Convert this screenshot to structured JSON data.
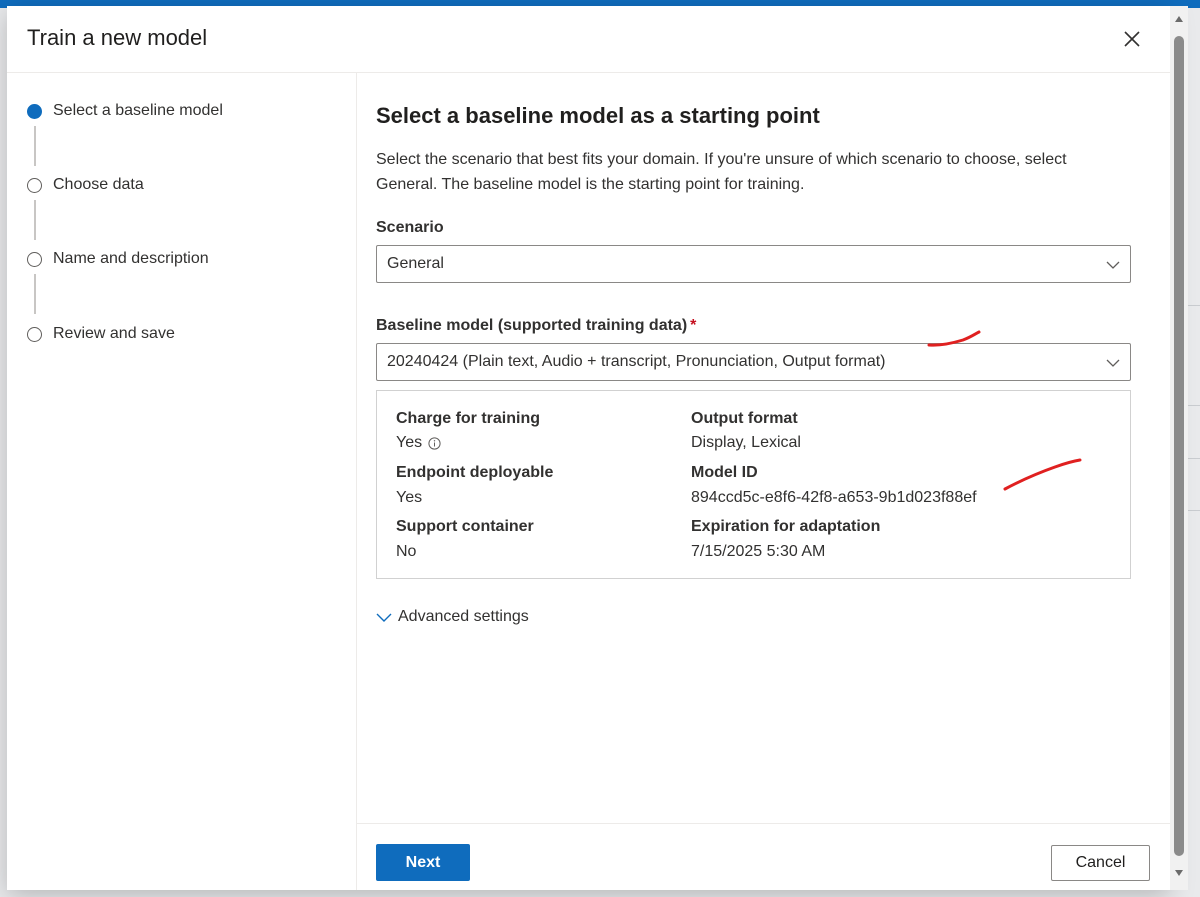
{
  "dialog": {
    "title": "Train a new model",
    "close_icon": "close-icon"
  },
  "steps": [
    {
      "label": "Select a baseline model",
      "state": "active"
    },
    {
      "label": "Choose data",
      "state": "pending"
    },
    {
      "label": "Name and description",
      "state": "pending"
    },
    {
      "label": "Review and save",
      "state": "pending"
    }
  ],
  "content": {
    "title": "Select a baseline model as a starting point",
    "description": "Select the scenario that best fits your domain. If you're unsure of which scenario to choose, select General. The baseline model is the starting point for training.",
    "scenario": {
      "label": "Scenario",
      "value": "General"
    },
    "baseline": {
      "label": "Baseline model (supported training data)",
      "required_mark": "*",
      "value": "20240424 (Plain text, Audio + transcript, Pronunciation, Output format)"
    },
    "details": {
      "charge_label": "Charge for training",
      "charge_value": "Yes",
      "charge_icon": "info-icon",
      "output_label": "Output format",
      "output_value": "Display, Lexical",
      "endpoint_label": "Endpoint deployable",
      "endpoint_value": "Yes",
      "model_id_label": "Model ID",
      "model_id_value": "894ccd5c-e8f6-42f8-a653-9b1d023f88ef",
      "container_label": "Support container",
      "container_value": "No",
      "expiration_label": "Expiration for adaptation",
      "expiration_value": "7/15/2025 5:30 AM"
    },
    "advanced_label": "Advanced settings"
  },
  "footer": {
    "next_label": "Next",
    "cancel_label": "Cancel"
  },
  "colors": {
    "accent": "#0f6cbd",
    "annotation": "#e02020",
    "required": "#c50f1f"
  }
}
